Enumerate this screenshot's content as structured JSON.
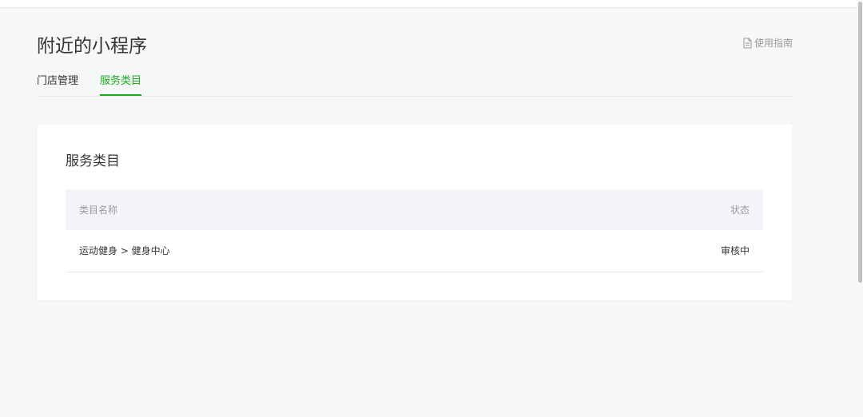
{
  "page": {
    "title": "附近的小程序",
    "guide_link": "使用指南"
  },
  "tabs": [
    {
      "label": "门店管理",
      "active": false
    },
    {
      "label": "服务类目",
      "active": true
    }
  ],
  "card": {
    "title": "服务类目",
    "table": {
      "headers": [
        "类目名称",
        "状态"
      ],
      "rows": [
        {
          "category": "运动健身 > 健身中心",
          "status": "审核中"
        }
      ]
    }
  },
  "colors": {
    "accent": "#1aad19",
    "background": "#f6f7f9",
    "card": "#ffffff",
    "table_header": "#f4f5f9"
  },
  "icons": {
    "guide": "document-icon"
  }
}
